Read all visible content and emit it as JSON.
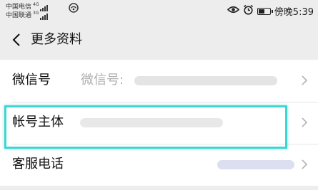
{
  "status_bar": {
    "carrier_1": "中国电信",
    "carrier_1_network": "4G",
    "carrier_2": "中国联通",
    "carrier_2_network": "3G",
    "wifi_icon": "wifi-icon",
    "eye_icon": "eye-icon",
    "alarm_icon": "alarm-icon",
    "battery_icon": "battery-icon",
    "time": "傍晚5:39"
  },
  "nav": {
    "back_icon": "chevron-left-icon",
    "title": "更多资料"
  },
  "rows": [
    {
      "label": "微信号",
      "value": "微信号:",
      "chevron_icon": "chevron-right-icon",
      "value_redacted": true
    },
    {
      "label": "帐号主体",
      "value": "",
      "chevron_icon": "chevron-right-icon",
      "value_redacted": true,
      "highlighted": true
    },
    {
      "label": "客服电话",
      "value": "",
      "chevron_icon": "chevron-right-icon",
      "value_redacted": true
    }
  ],
  "colors": {
    "background": "#ededed",
    "row_background": "#ffffff",
    "highlight_border": "#3ed6d0",
    "secondary_text": "#b0b0b0",
    "redaction": "#e0e0e0",
    "redaction_phone": "#dcdff0"
  }
}
